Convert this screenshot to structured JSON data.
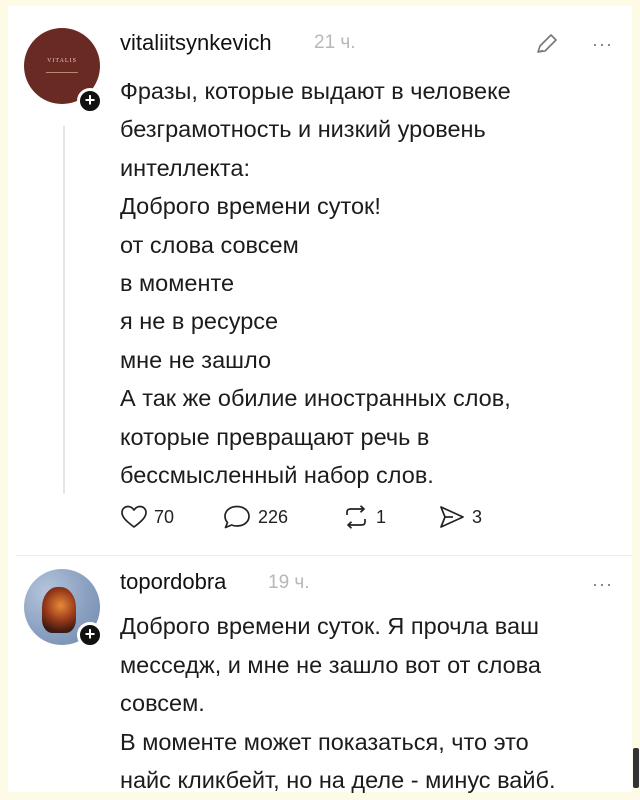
{
  "post1": {
    "username": "vitaliitsynkevich",
    "time": "21 ч.",
    "avatar_label": "VITALIS",
    "lines": [
      "Фразы, которые выдают в человеке",
      "безграмотность и низкий уровень",
      "интеллекта:",
      "Доброго времени суток!",
      "от слова совсем",
      "в моменте",
      "я не в ресурсе",
      "мне не зашло",
      "А так же обилие иностранных слов,",
      "которые превращают речь в",
      "бессмысленный набор слов."
    ],
    "actions": {
      "likes": "70",
      "comments": "226",
      "reposts": "1",
      "shares": "3"
    },
    "more": "···"
  },
  "post2": {
    "username": "topordobra",
    "time": "19 ч.",
    "lines": [
      "Доброго времени суток. Я прочла ваш",
      "месседж, и мне не зашло вот от слова",
      "совсем.",
      "В моменте может показаться, что это",
      "найс кликбейт, но на деле - минус вайб."
    ],
    "more": "···"
  },
  "icons": {
    "follow": "+",
    "edit": "pencil-icon",
    "like": "heart-icon",
    "comment": "speech-bubble-icon",
    "repost": "repost-icon",
    "share": "send-icon"
  }
}
